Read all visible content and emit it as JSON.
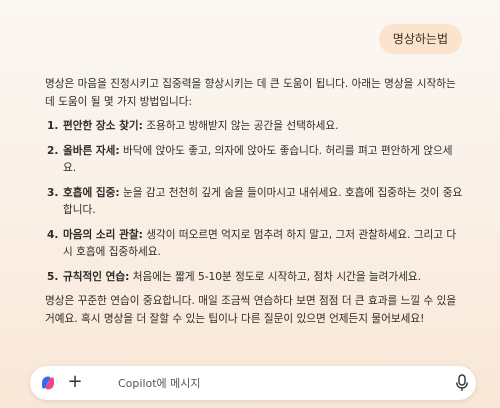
{
  "conversation": {
    "user_message": "명상하는법",
    "intro": "명상은 마음을 진정시키고 집중력을 향상시키는 데 큰 도움이 됩니다. 아래는 명상을 시작하는 데 도움이 될 몇 가지 방법입니다:",
    "steps": [
      {
        "num": "1.",
        "title": "편안한 장소 찾기:",
        "text": " 조용하고 방해받지 않는 공간을 선택하세요."
      },
      {
        "num": "2.",
        "title": "올바른 자세:",
        "text": " 바닥에 앉아도 좋고, 의자에 앉아도 좋습니다. 허리를 펴고 편안하게 앉으세요."
      },
      {
        "num": "3.",
        "title": "호흡에 집중:",
        "text": " 눈을 감고 천천히 깊게 숨을 들이마시고 내쉬세요. 호흡에 집중하는 것이 중요합니다."
      },
      {
        "num": "4.",
        "title": "마음의 소리 관찰:",
        "text": " 생각이 떠오르면 억지로 멈추려 하지 말고, 그저 관찰하세요. 그리고 다시 호흡에 집중하세요."
      },
      {
        "num": "5.",
        "title": "규칙적인 연습:",
        "text": " 처음에는 짧게 5-10분 정도로 시작하고, 점차 시간을 늘려가세요."
      }
    ],
    "outro": "명상은 꾸준한 연습이 중요합니다. 매일 조금씩 연습하다 보면 점점 더 큰 효과를 느낄 수 있을 거예요. 혹시 명상을 더 잘할 수 있는 팁이나 다른 질문이 있으면 언제든지 물어보세요!"
  },
  "composer": {
    "placeholder": "Copilot에 메시지",
    "icons": [
      "copilot-logo-icon",
      "plus-icon",
      "microphone-icon"
    ]
  },
  "colors": {
    "user_bubble": "#fbe3cd",
    "background_top": "#fbf7f3",
    "background_bottom": "#f9e7d6"
  }
}
